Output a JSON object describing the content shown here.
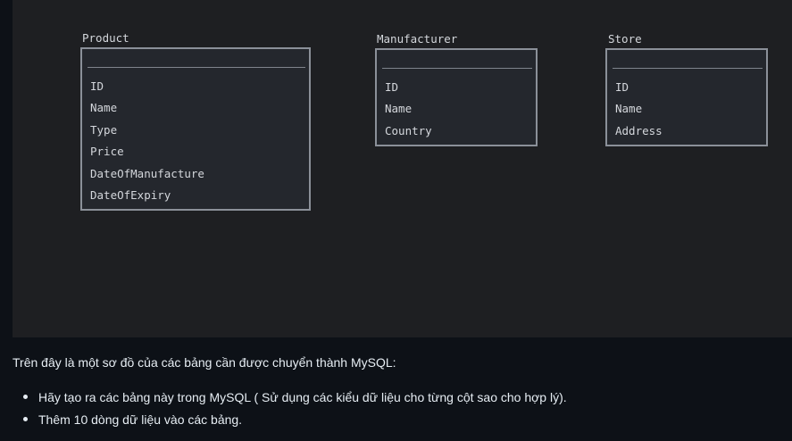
{
  "diagram": {
    "entities": [
      {
        "name": "Product",
        "fields": [
          "ID",
          "Name",
          "Type",
          "Price",
          "DateOfManufacture",
          "DateOfExpiry"
        ]
      },
      {
        "name": "Manufacturer",
        "fields": [
          "ID",
          "Name",
          "Country"
        ]
      },
      {
        "name": "Store",
        "fields": [
          "ID",
          "Name",
          "Address"
        ]
      }
    ]
  },
  "content": {
    "description": "Trên đây là một sơ đồ của các bảng cần được chuyển thành MySQL:",
    "tasks": [
      "Hãy tạo ra các bảng này trong MySQL ( Sử dụng các kiểu dữ liệu cho từng cột sao cho hợp lý).",
      "Thêm 10 dòng dữ liệu vào các bảng."
    ]
  },
  "colors": {
    "page_background": "#0d1117",
    "diagram_background": "#1e1f22",
    "entity_border": "#8b9099",
    "text": "#e6edf3"
  }
}
